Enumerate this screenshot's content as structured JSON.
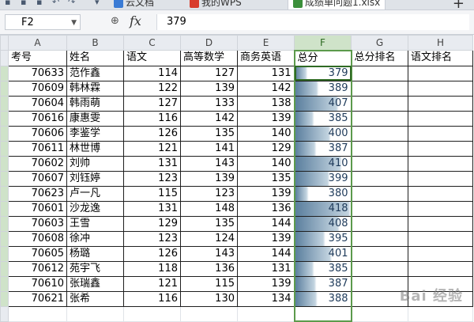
{
  "tabs": [
    {
      "label": "云文档",
      "icon": "cloud-doc-icon",
      "color": "#3a7bd5"
    },
    {
      "label": "我的WPS",
      "icon": "wps-w-icon",
      "color": "#d83b2b"
    },
    {
      "label": "成绩单问题1.xlsx",
      "icon": "spreadsheet-icon",
      "color": "#3b8f3b",
      "active": true
    }
  ],
  "formula_bar": {
    "cell_ref": "F2",
    "fx_label": "fx",
    "value": "379"
  },
  "columns": [
    "A",
    "B",
    "C",
    "D",
    "E",
    "F",
    "G",
    "H"
  ],
  "selected_column": "F",
  "headers": [
    "考号",
    "姓名",
    "语文",
    "高等数学",
    "商务英语",
    "总分",
    "总分排名",
    "语文排名"
  ],
  "rows": [
    {
      "id": "70633",
      "name": "范作鑫",
      "chinese": "114",
      "math": "127",
      "english": "131",
      "total": "379"
    },
    {
      "id": "70609",
      "name": "韩林霖",
      "chinese": "122",
      "math": "139",
      "english": "142",
      "total": "389"
    },
    {
      "id": "70604",
      "name": "韩雨萌",
      "chinese": "127",
      "math": "133",
      "english": "138",
      "total": "407"
    },
    {
      "id": "70616",
      "name": "康惠雯",
      "chinese": "116",
      "math": "142",
      "english": "139",
      "total": "385"
    },
    {
      "id": "70606",
      "name": "李鉴学",
      "chinese": "126",
      "math": "135",
      "english": "140",
      "total": "400"
    },
    {
      "id": "70611",
      "name": "林世博",
      "chinese": "121",
      "math": "141",
      "english": "129",
      "total": "387"
    },
    {
      "id": "70602",
      "name": "刘帅",
      "chinese": "131",
      "math": "143",
      "english": "140",
      "total": "410"
    },
    {
      "id": "70607",
      "name": "刘钰婷",
      "chinese": "123",
      "math": "139",
      "english": "135",
      "total": "399"
    },
    {
      "id": "70623",
      "name": "卢一凡",
      "chinese": "115",
      "math": "123",
      "english": "139",
      "total": "380"
    },
    {
      "id": "70601",
      "name": "沙龙逸",
      "chinese": "131",
      "math": "148",
      "english": "136",
      "total": "418"
    },
    {
      "id": "70603",
      "name": "王雪",
      "chinese": "129",
      "math": "135",
      "english": "144",
      "total": "408"
    },
    {
      "id": "70608",
      "name": "徐冲",
      "chinese": "123",
      "math": "124",
      "english": "139",
      "total": "395"
    },
    {
      "id": "70605",
      "name": "杨璐",
      "chinese": "126",
      "math": "143",
      "english": "144",
      "total": "401"
    },
    {
      "id": "70612",
      "name": "苑宇飞",
      "chinese": "118",
      "math": "136",
      "english": "131",
      "total": "385"
    },
    {
      "id": "70610",
      "name": "张瑞鑫",
      "chinese": "121",
      "math": "115",
      "english": "139",
      "total": "387"
    },
    {
      "id": "70621",
      "name": "张希",
      "chinese": "116",
      "math": "130",
      "english": "134",
      "total": "388"
    }
  ],
  "data_bar": {
    "min": 370,
    "max": 420,
    "color_start": "#5b7f9e",
    "color_end": "#ffffff"
  },
  "watermark": "Bai 经验",
  "accent_color": "#5c9a4c"
}
